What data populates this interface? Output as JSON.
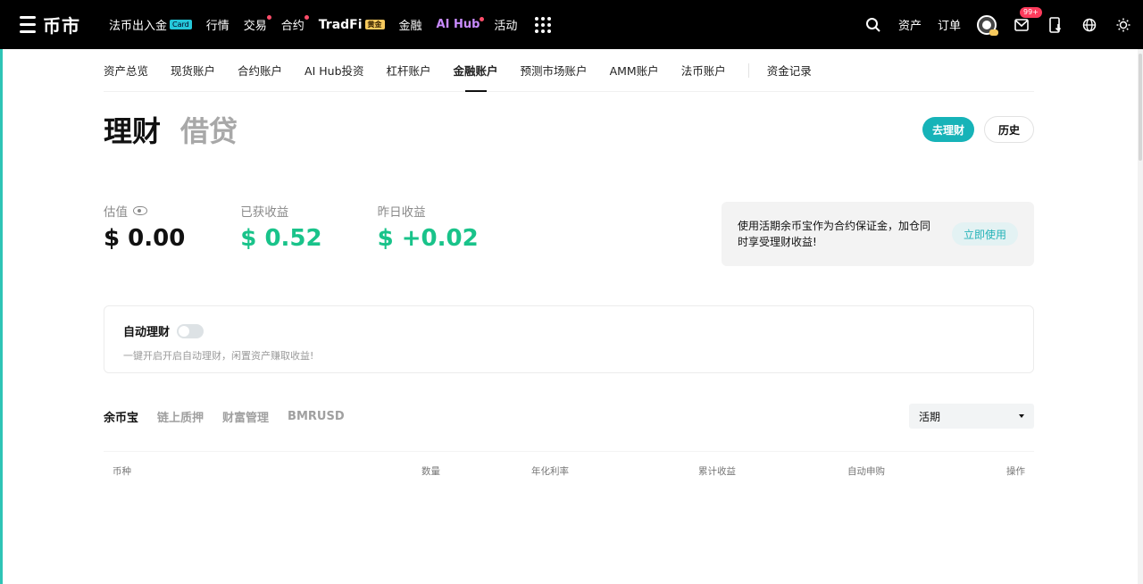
{
  "brand": {
    "name": "币市"
  },
  "nav": {
    "items": [
      {
        "label": "法币出入金",
        "tag": "Card"
      },
      {
        "label": "行情"
      },
      {
        "label": "交易",
        "dot": true
      },
      {
        "label": "合约",
        "dot": true
      },
      {
        "label": "TradFi",
        "tag": "黄金"
      },
      {
        "label": "金融"
      },
      {
        "label": "AI Hub",
        "dot": true
      },
      {
        "label": "活动"
      }
    ],
    "assets": "资产",
    "orders": "订单",
    "notifications_badge": "99+"
  },
  "subnav": {
    "tabs": [
      "资产总览",
      "现货账户",
      "合约账户",
      "AI Hub投资",
      "杠杆账户",
      "金融账户",
      "预测市场账户",
      "AMM账户",
      "法币账户"
    ],
    "active": "金融账户",
    "records": "资金记录"
  },
  "header": {
    "tab_active": "理财",
    "tab_inactive": "借贷",
    "btn_primary": "去理财",
    "btn_history": "历史"
  },
  "stats": {
    "valuation_label": "估值",
    "valuation_value": "$ 0.00",
    "earned_label": "已获收益",
    "earned_value": "$ 0.52",
    "yesterday_label": "昨日收益",
    "yesterday_value": "$ +0.02"
  },
  "promo": {
    "text": "使用活期余币宝作为合约保证金，加仓同时享受理财收益!",
    "button": "立即使用"
  },
  "auto": {
    "title": "自动理财",
    "enabled": false,
    "desc": "一键开启开启自动理财，闲置资产赚取收益!"
  },
  "products": {
    "tabs": [
      "余币宝",
      "链上质押",
      "财富管理",
      "BMRUSD"
    ],
    "active": "余币宝",
    "select_value": "活期"
  },
  "table": {
    "columns": [
      "币种",
      "数量",
      "年化利率",
      "累计收益",
      "自动申购",
      "操作"
    ]
  },
  "colors": {
    "accent": "#16b3b8",
    "positive": "#19c38a",
    "nav_bg": "#000000",
    "badge": "#ff3b5c"
  }
}
